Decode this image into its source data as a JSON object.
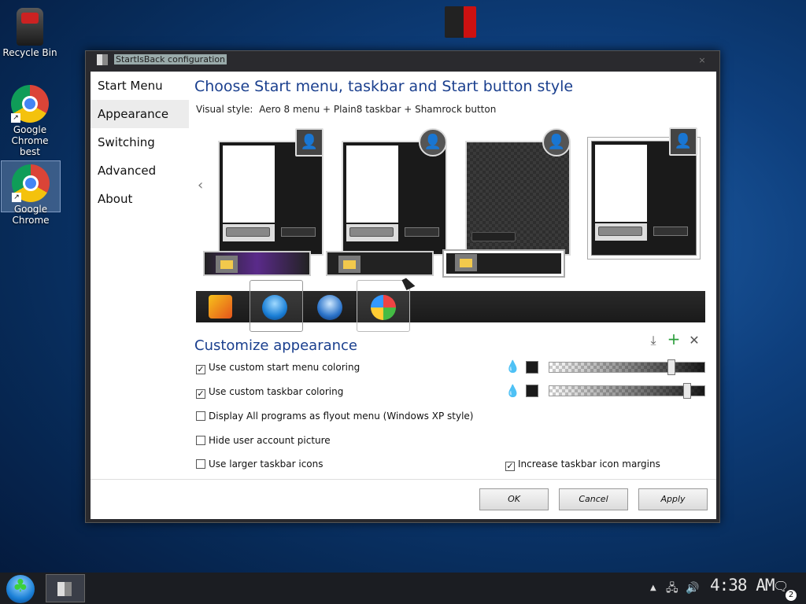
{
  "desktop": {
    "icons": [
      {
        "label": "Recycle Bin"
      },
      {
        "label": "Google Chrome best"
      },
      {
        "label": "Google Chrome"
      }
    ]
  },
  "window": {
    "title": "StartIsBack configuration",
    "close_glyph": "×",
    "sidebar": [
      "Start Menu",
      "Appearance",
      "Switching",
      "Advanced",
      "About"
    ],
    "active_sidebar": "Appearance",
    "style_heading": "Choose Start menu, taskbar and Start button style",
    "visual_style_label": "Visual style:",
    "visual_style_value": "Aero 8 menu + Plain8 taskbar + Shamrock button",
    "prev_arrow": "‹",
    "customize_heading": "Customize appearance",
    "tool_icons": [
      "download-icon",
      "plus-icon",
      "close-icon"
    ],
    "tool_glyphs": [
      "⤓",
      "+",
      "✕"
    ],
    "options": [
      {
        "label": "Use custom start menu coloring",
        "checked": true
      },
      {
        "label": "Use custom taskbar coloring",
        "checked": true
      },
      {
        "label": "Display All programs as flyout menu (Windows XP style)",
        "checked": false
      },
      {
        "label": "Hide user account picture",
        "checked": false
      },
      {
        "label": "Use larger taskbar icons",
        "checked": false
      },
      {
        "label": "Increase taskbar icon margins",
        "checked": true
      }
    ],
    "sliders": [
      {
        "name": "start-menu-opacity",
        "value": 0.78
      },
      {
        "name": "taskbar-opacity",
        "value": 0.88
      }
    ],
    "buttons": {
      "ok": "OK",
      "cancel": "Cancel",
      "apply": "Apply"
    }
  },
  "taskbar": {
    "clock": "4:38 AM",
    "notification_count": "2",
    "tray_icons": [
      "up-arrow-icon",
      "network-icon",
      "volume-icon",
      "notification-icon"
    ]
  },
  "colors": {
    "accent_blue": "#1a3f8e",
    "window_frame": "#2a2a2e",
    "taskbar": "#1b1d22"
  }
}
